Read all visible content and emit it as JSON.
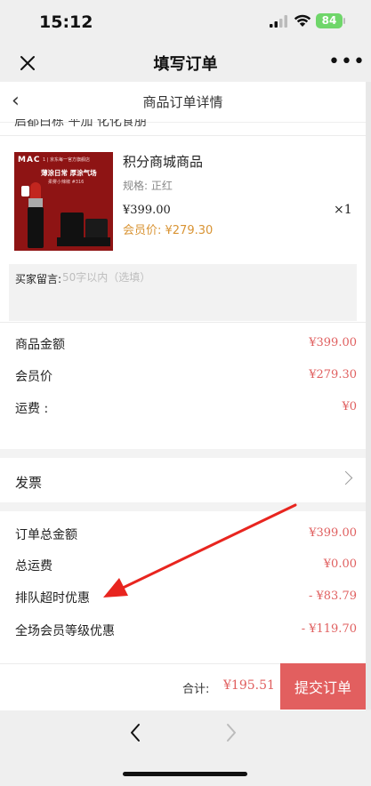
{
  "status": {
    "time": "15:12",
    "battery": "84"
  },
  "wechat": {
    "title": "填写订单",
    "close_icon": "close-icon",
    "more_label": "•••"
  },
  "header": {
    "title": "商品订单详情",
    "back_glyph": "‹"
  },
  "address_cut": "启都白栋 平加 化化食朋",
  "product": {
    "image_brand": "MAC",
    "image_tag": "1 | 京东每一官方旗舰店",
    "image_headline": "薄涂日常 厚涂气场",
    "image_sub": "柔雾小辣椒 #316",
    "title": "积分商城商品",
    "spec": "规格: 正红",
    "price": "¥399.00",
    "member_price": "会员价: ¥279.30",
    "qty": "×1"
  },
  "remark": {
    "label": "买家留言:",
    "placeholder": "50字以内（选填）"
  },
  "summary1": [
    {
      "label": "商品金额",
      "value": "¥399.00"
    },
    {
      "label": "会员价",
      "value": "¥279.30"
    },
    {
      "label": "运费 :",
      "value": "¥0"
    }
  ],
  "invoice": {
    "label": "发票"
  },
  "summary2": [
    {
      "label": "订单总金额",
      "value": "¥399.00"
    },
    {
      "label": "总运费",
      "value": "¥0.00"
    },
    {
      "label": "排队超时优惠",
      "value": "- ¥83.79"
    },
    {
      "label": "全场会员等级优惠",
      "value": "- ¥119.70"
    }
  ],
  "footer": {
    "total_label": "合计:",
    "total_value": "¥195.51",
    "submit_label": "提交订单"
  },
  "colors": {
    "accent_red": "#e25f5f",
    "price_red": "#e06060",
    "member_orange": "#d99434",
    "arrow_red": "#e8251f"
  }
}
